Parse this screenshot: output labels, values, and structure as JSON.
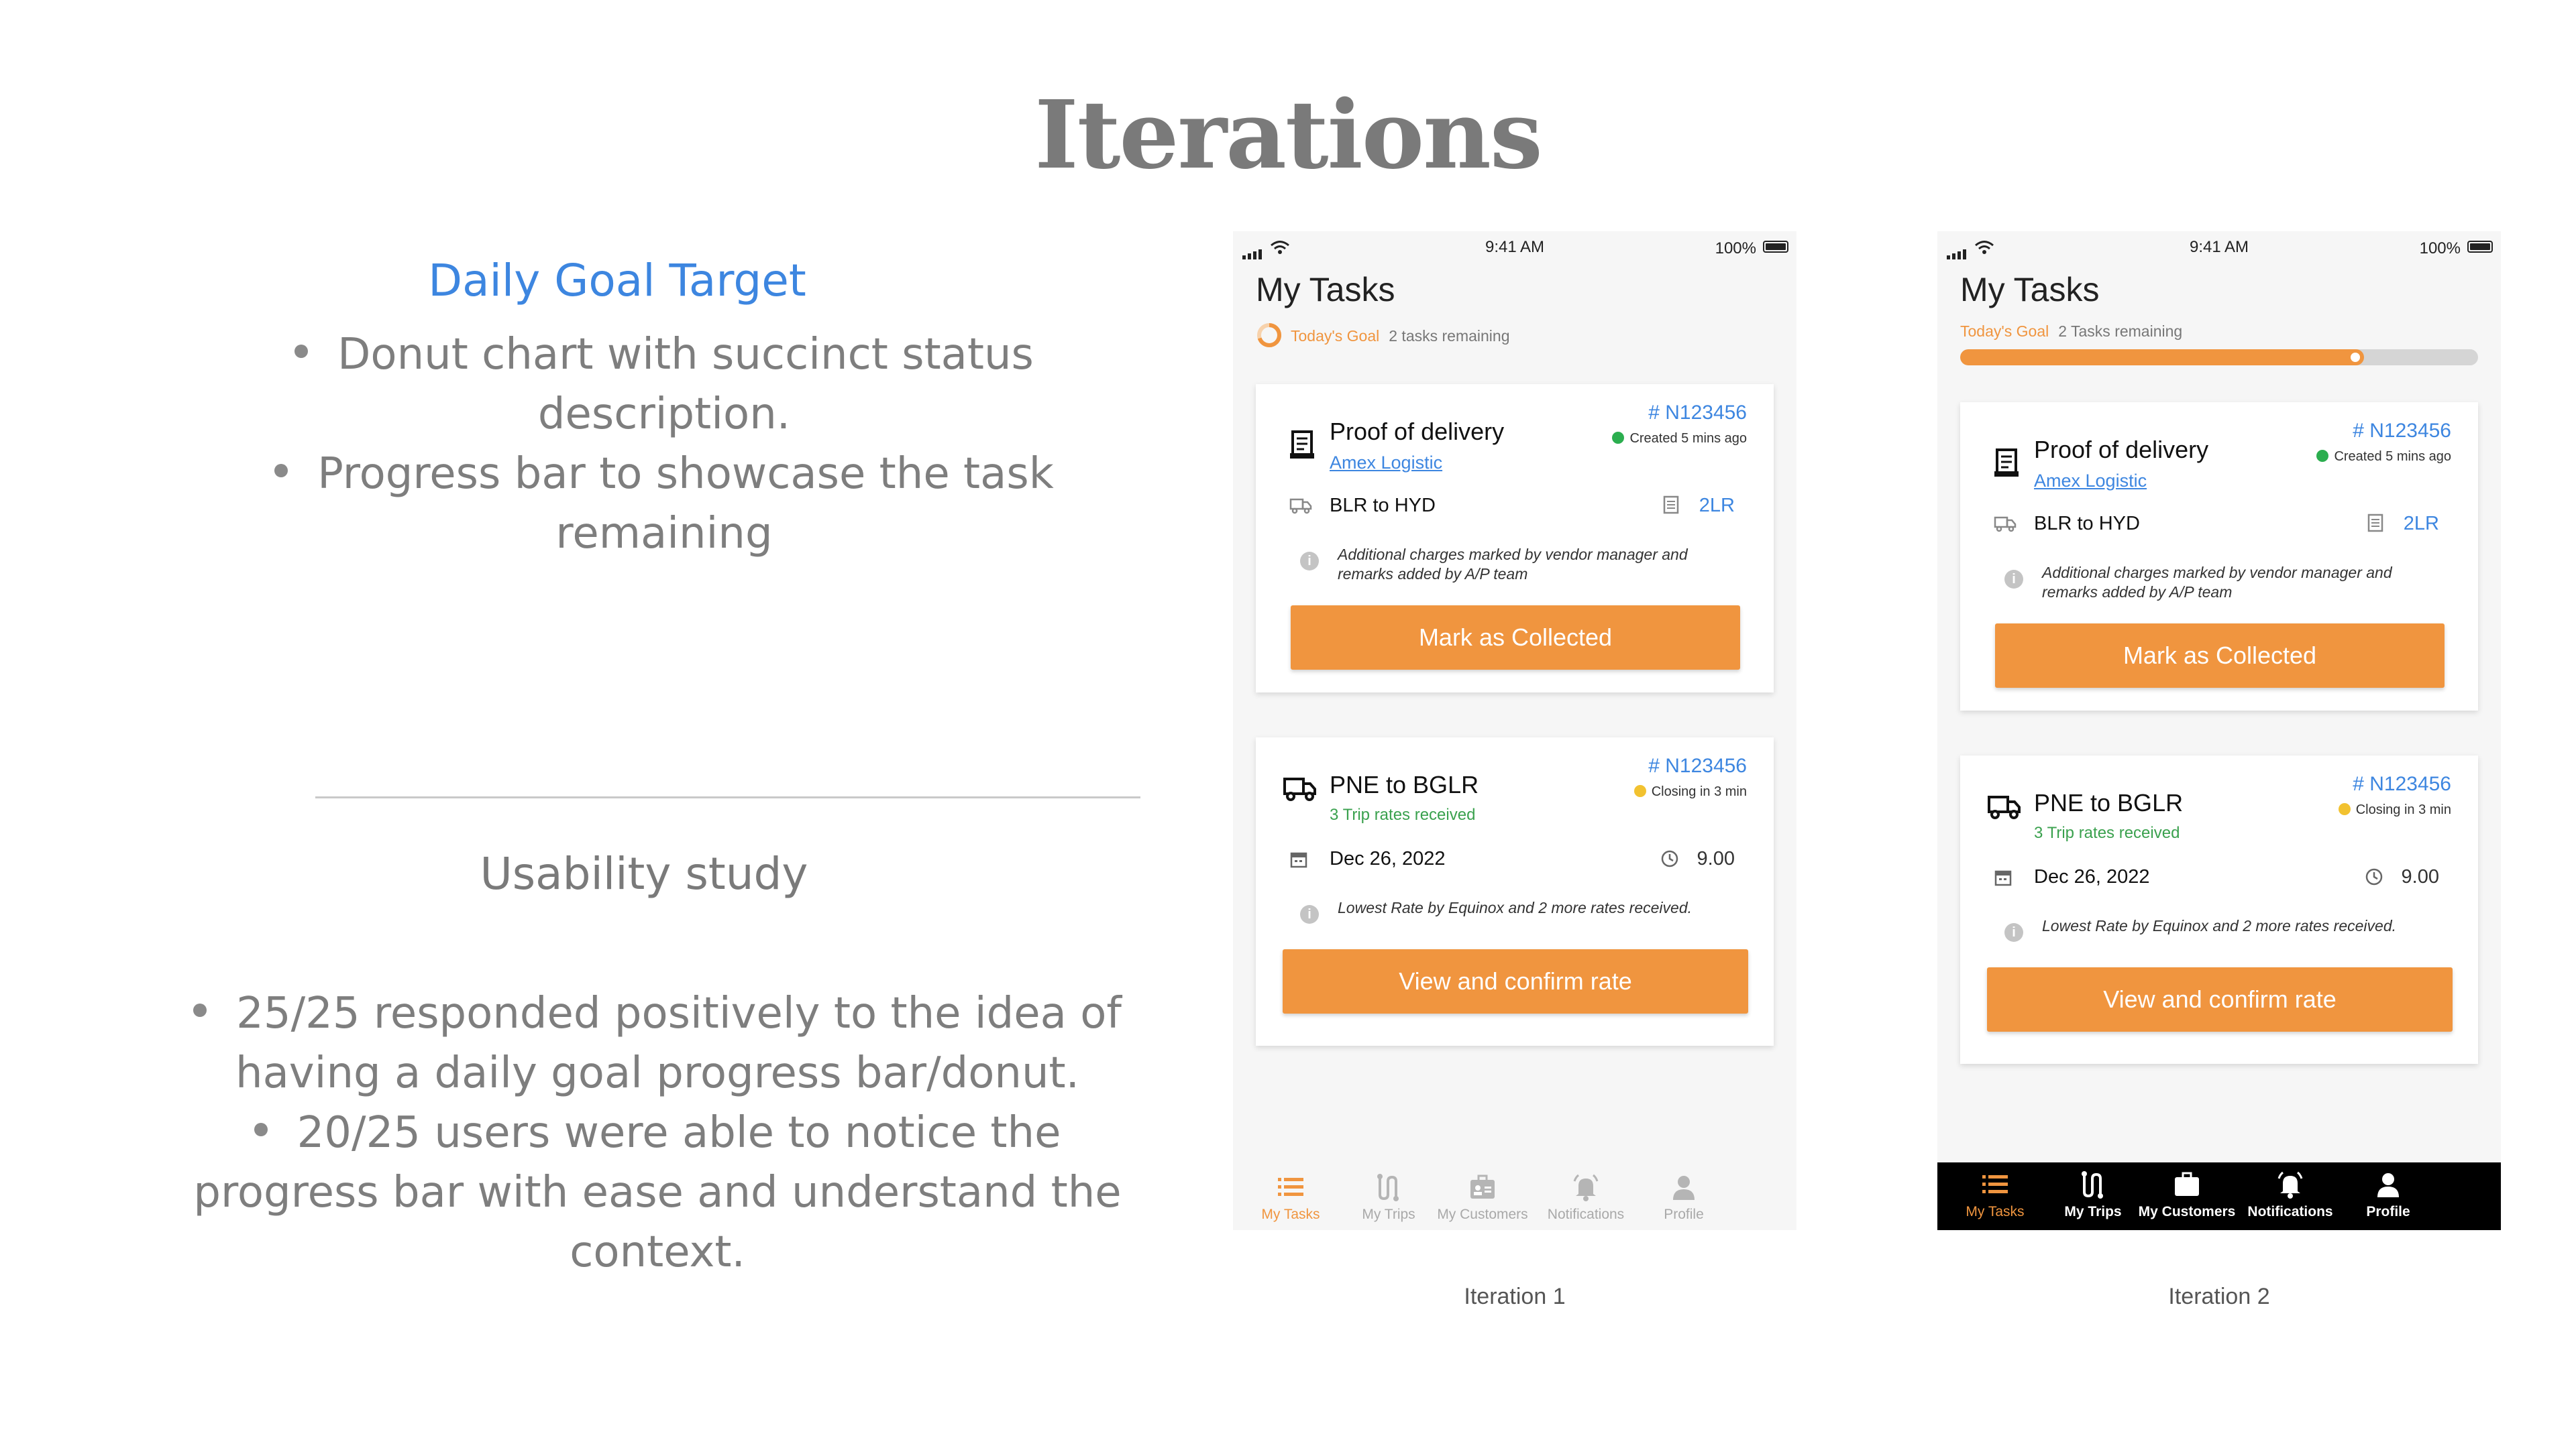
{
  "slide": {
    "title": "Iterations"
  },
  "daily_goal": {
    "title": "Daily Goal Target",
    "bullets": [
      "Donut chart with succinct status description.",
      "Progress bar to showcase the task remaining"
    ]
  },
  "usability": {
    "title": "Usability study",
    "bullets": [
      "25/25 responded positively to the idea of having a daily goal progress bar/donut.",
      "20/25 users were able to notice the progress bar with ease and understand the context."
    ]
  },
  "iterations": [
    {
      "caption": "Iteration 1",
      "status_bar": {
        "time": "9:41 AM",
        "battery": "100%"
      },
      "screen_title": "My Tasks",
      "goal": {
        "label": "Today's Goal",
        "remaining": "2 tasks remaining",
        "style": "donut",
        "progress": 0.7
      },
      "cards": [
        {
          "title": "Proof of delivery",
          "subtitle": "Amex Logistic",
          "id": "# N123456",
          "status": "Created 5 mins ago",
          "status_color": "#2bae4f",
          "route": "BLR to HYD",
          "right_value": "2LR",
          "note": "Additional charges marked by vendor manager and remarks added by A/P team",
          "button": "Mark as Collected"
        },
        {
          "title": "PNE to BGLR",
          "subtitle": "3 Trip rates received",
          "id": "# N123456",
          "status": "Closing in 3 min",
          "status_color": "#f2c230",
          "date": "Dec 26, 2022",
          "right_value": "9.00",
          "note": "Lowest Rate by Equinox and 2 more rates received.",
          "button": "View and confirm rate"
        }
      ],
      "tabs": [
        "My Tasks",
        "My Trips",
        "My Customers",
        "Notifications",
        "Profile"
      ],
      "tab_icons": [
        "list-icon",
        "route-icon",
        "customers-icon",
        "bell-icon",
        "user-icon"
      ],
      "active_tab": "My Tasks"
    },
    {
      "caption": "Iteration 2",
      "status_bar": {
        "time": "9:41 AM",
        "battery": "100%"
      },
      "screen_title": "My Tasks",
      "goal": {
        "label": "Today's Goal",
        "remaining": "2 Tasks remaining",
        "style": "bar",
        "progress": 0.78
      },
      "cards": [
        {
          "title": "Proof of delivery",
          "subtitle": "Amex Logistic",
          "id": "# N123456",
          "status": "Created 5 mins ago",
          "status_color": "#2bae4f",
          "route": "BLR to HYD",
          "right_value": "2LR",
          "note": "Additional charges marked by vendor manager and remarks added by A/P team",
          "button": "Mark as Collected"
        },
        {
          "title": "PNE to BGLR",
          "subtitle": "3 Trip rates received",
          "id": "# N123456",
          "status": "Closing in 3 min",
          "status_color": "#f2c230",
          "date": "Dec 26, 2022",
          "right_value": "9.00",
          "note": "Lowest Rate by Equinox and 2 more rates received.",
          "button": "View and confirm rate"
        }
      ],
      "tabs": [
        "My Tasks",
        "My Trips",
        "My Customers",
        "Notifications",
        "Profile"
      ],
      "tab_icons": [
        "list-icon",
        "route-icon",
        "customers-icon",
        "bell-icon",
        "user-icon"
      ],
      "active_tab": "My Tasks"
    }
  ],
  "colors": {
    "accent": "#f0953f",
    "link": "#3d86e0",
    "green": "#2bae4f",
    "yellow": "#f2c230"
  }
}
